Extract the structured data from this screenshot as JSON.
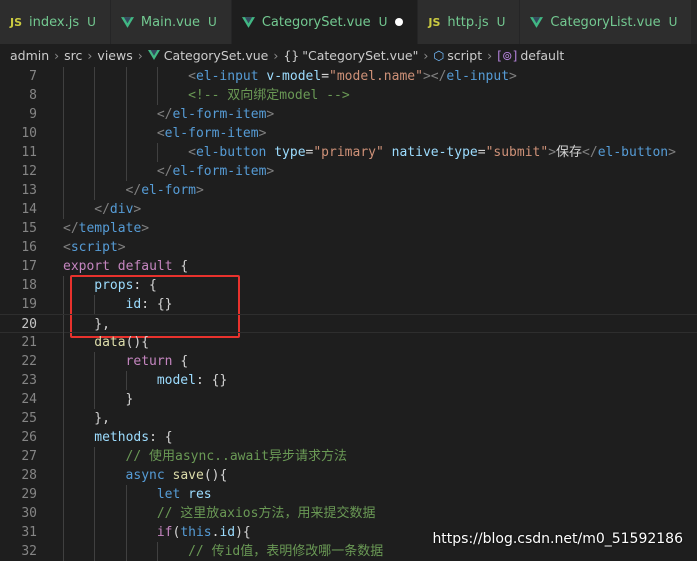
{
  "tabs": [
    {
      "icon": "JS",
      "type": "js",
      "name": "index.js",
      "badge": "U",
      "active": false,
      "dirty": false
    },
    {
      "icon": "vue",
      "type": "vue",
      "name": "Main.vue",
      "badge": "U",
      "active": false,
      "dirty": false
    },
    {
      "icon": "vue",
      "type": "vue",
      "name": "CategorySet.vue",
      "badge": "U",
      "active": true,
      "dirty": true
    },
    {
      "icon": "JS",
      "type": "js",
      "name": "http.js",
      "badge": "U",
      "active": false,
      "dirty": false
    },
    {
      "icon": "vue",
      "type": "vue",
      "name": "CategoryList.vue",
      "badge": "U",
      "active": false,
      "dirty": false
    }
  ],
  "breadcrumb": [
    "admin",
    "src",
    "views",
    "CategorySet.vue",
    "\"CategorySet.vue\"",
    "script",
    "default"
  ],
  "editor": {
    "active_line": 20,
    "lines": [
      {
        "n": "7",
        "tokens": [
          [
            "pun",
            "        <"
          ],
          [
            "tag",
            "el-input"
          ],
          [
            "txt",
            " "
          ],
          [
            "attr",
            "v-model"
          ],
          [
            "txt",
            "="
          ],
          [
            "str",
            "\"model.name\""
          ],
          [
            "pun",
            "></"
          ],
          [
            "tag",
            "el-input"
          ],
          [
            "pun",
            ">"
          ]
        ]
      },
      {
        "n": "8",
        "tokens": [
          [
            "com",
            "        <!-- 双向绑定model -->"
          ]
        ]
      },
      {
        "n": "9",
        "tokens": [
          [
            "pun",
            "    </"
          ],
          [
            "tag",
            "el-form-item"
          ],
          [
            "pun",
            ">"
          ]
        ]
      },
      {
        "n": "10",
        "tokens": [
          [
            "pun",
            "    <"
          ],
          [
            "tag",
            "el-form-item"
          ],
          [
            "pun",
            ">"
          ]
        ]
      },
      {
        "n": "11",
        "tokens": [
          [
            "pun",
            "        <"
          ],
          [
            "tag",
            "el-button"
          ],
          [
            "txt",
            " "
          ],
          [
            "attr",
            "type"
          ],
          [
            "txt",
            "="
          ],
          [
            "str",
            "\"primary\""
          ],
          [
            "txt",
            " "
          ],
          [
            "attr",
            "native-type"
          ],
          [
            "txt",
            "="
          ],
          [
            "str",
            "\"submit\""
          ],
          [
            "pun",
            ">"
          ],
          [
            "txt",
            "保存"
          ],
          [
            "pun",
            "</"
          ],
          [
            "tag",
            "el-button"
          ],
          [
            "pun",
            ">"
          ]
        ]
      },
      {
        "n": "12",
        "tokens": [
          [
            "pun",
            "    </"
          ],
          [
            "tag",
            "el-form-item"
          ],
          [
            "pun",
            ">"
          ]
        ]
      },
      {
        "n": "13",
        "tokens": [
          [
            "pun",
            "</"
          ],
          [
            "tag",
            "el-form"
          ],
          [
            "pun",
            ">"
          ]
        ]
      },
      {
        "n": "14",
        "tokens": [
          [
            "pun",
            "</"
          ],
          [
            "tag",
            "div"
          ],
          [
            "pun",
            ">"
          ]
        ]
      },
      {
        "n": "15",
        "tokens": [
          [
            "pun",
            "</"
          ],
          [
            "tag",
            "template"
          ],
          [
            "pun",
            ">"
          ]
        ]
      },
      {
        "n": "16",
        "tokens": [
          [
            "pun",
            "<"
          ],
          [
            "tag",
            "script"
          ],
          [
            "pun",
            ">"
          ]
        ]
      },
      {
        "n": "17",
        "tokens": [
          [
            "ctl",
            "export"
          ],
          [
            "txt",
            " "
          ],
          [
            "ctl",
            "default"
          ],
          [
            "txt",
            " {"
          ]
        ]
      },
      {
        "n": "18",
        "tokens": [
          [
            "var",
            "props"
          ],
          [
            "txt",
            ": {"
          ]
        ]
      },
      {
        "n": "19",
        "tokens": [
          [
            "var",
            "id"
          ],
          [
            "txt",
            ": {}"
          ]
        ]
      },
      {
        "n": "20",
        "tokens": [
          [
            "txt",
            "},"
          ]
        ]
      },
      {
        "n": "21",
        "tokens": [
          [
            "fn",
            "data"
          ],
          [
            "txt",
            "(){"
          ]
        ]
      },
      {
        "n": "22",
        "tokens": [
          [
            "ctl",
            "return"
          ],
          [
            "txt",
            " {"
          ]
        ]
      },
      {
        "n": "23",
        "tokens": [
          [
            "var",
            "model"
          ],
          [
            "txt",
            ": {}"
          ]
        ]
      },
      {
        "n": "24",
        "tokens": [
          [
            "txt",
            "}"
          ]
        ]
      },
      {
        "n": "25",
        "tokens": [
          [
            "txt",
            "},"
          ]
        ]
      },
      {
        "n": "26",
        "tokens": [
          [
            "var",
            "methods"
          ],
          [
            "txt",
            ": {"
          ]
        ]
      },
      {
        "n": "27",
        "tokens": [
          [
            "com",
            "// 使用async..await异步请求方法"
          ]
        ]
      },
      {
        "n": "28",
        "tokens": [
          [
            "kw",
            "async"
          ],
          [
            "txt",
            " "
          ],
          [
            "fn",
            "save"
          ],
          [
            "txt",
            "(){"
          ]
        ]
      },
      {
        "n": "29",
        "tokens": [
          [
            "kw",
            "let"
          ],
          [
            "txt",
            " "
          ],
          [
            "var",
            "res"
          ]
        ]
      },
      {
        "n": "30",
        "tokens": [
          [
            "com",
            "// 这里放axios方法，用来提交数据"
          ]
        ]
      },
      {
        "n": "31",
        "tokens": [
          [
            "ctl",
            "if"
          ],
          [
            "txt",
            "("
          ],
          [
            "kw",
            "this"
          ],
          [
            "txt",
            "."
          ],
          [
            "var",
            "id"
          ],
          [
            "txt",
            "){"
          ]
        ]
      },
      {
        "n": "32",
        "tokens": [
          [
            "com",
            "// 传id值，表明修改哪一条数据"
          ]
        ]
      }
    ]
  },
  "watermark": "https://blog.csdn.net/m0_51592186"
}
